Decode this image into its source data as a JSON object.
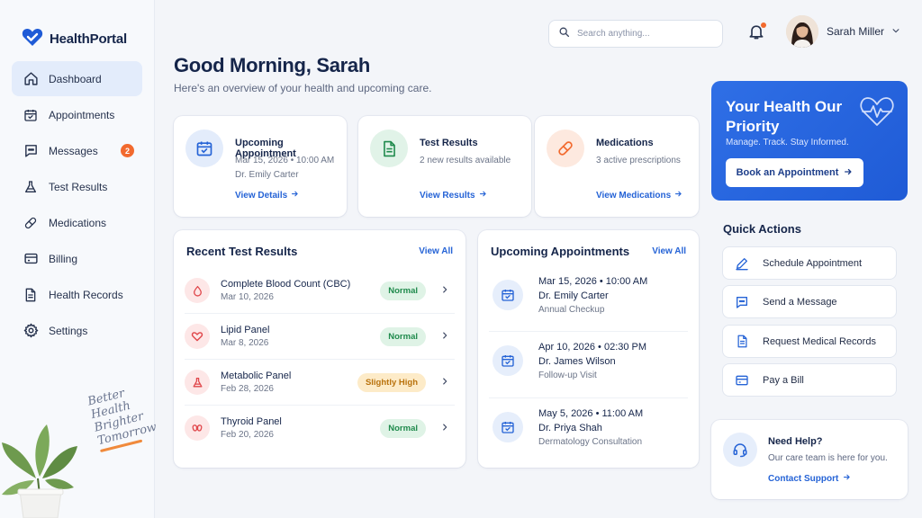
{
  "brand": {
    "name": "HealthPortal",
    "logo_icon": "heart-logo-icon",
    "color": "#1f5bd6"
  },
  "sidebar": {
    "items": [
      {
        "label": "Dashboard",
        "icon": "home-icon",
        "active": true
      },
      {
        "label": "Appointments",
        "icon": "calendar-icon"
      },
      {
        "label": "Messages",
        "icon": "chat-icon",
        "badge": "2"
      },
      {
        "label": "Test Results",
        "icon": "flask-icon"
      },
      {
        "label": "Medications",
        "icon": "pill-icon"
      },
      {
        "label": "Billing",
        "icon": "credit-card-icon"
      },
      {
        "label": "Health Records",
        "icon": "document-icon"
      },
      {
        "label": "Settings",
        "icon": "gear-icon"
      }
    ],
    "tagline": [
      "Better",
      "Health",
      "Brighter",
      "Tomorrow"
    ]
  },
  "header": {
    "search_placeholder": "Search anything...",
    "user_name": "Sarah Miller"
  },
  "greeting": {
    "title": "Good Morning, Sarah",
    "subtitle": "Here's an overview of your health and upcoming care."
  },
  "summary_cards": [
    {
      "title": "Upcoming Appointment",
      "line1": "Mar 15, 2026 • 10:00 AM",
      "line2": "Dr. Emily Carter",
      "link": "View Details",
      "icon": "calendar-icon",
      "accent": "#2563d6"
    },
    {
      "title": "Test Results",
      "line1": "2 new results available",
      "link": "View Results",
      "icon": "document-icon",
      "accent": "#1f8a4c"
    },
    {
      "title": "Medications",
      "line1": "3 active prescriptions",
      "link": "View Medications",
      "icon": "pill-icon",
      "accent": "#f26a2e"
    }
  ],
  "recent_results": {
    "title": "Recent Test Results",
    "link": "View All",
    "rows": [
      {
        "name": "Complete Blood Count (CBC)",
        "date": "Mar 10, 2026",
        "status": "Normal",
        "icon": "blood-drop-icon"
      },
      {
        "name": "Lipid Panel",
        "date": "Mar 8, 2026",
        "status": "Normal",
        "icon": "heart-icon"
      },
      {
        "name": "Metabolic Panel",
        "date": "Feb 28, 2026",
        "status": "Slightly High",
        "icon": "flask-icon"
      },
      {
        "name": "Thyroid Panel",
        "date": "Feb 20, 2026",
        "status": "Normal",
        "icon": "thyroid-icon"
      }
    ]
  },
  "upcoming_appointments": {
    "title": "Upcoming Appointments",
    "link": "View All",
    "rows": [
      {
        "date": "Mar 15, 2026 • 10:00 AM",
        "doctor": "Dr. Emily Carter",
        "type": "Annual Checkup"
      },
      {
        "date": "Apr 10, 2026 • 02:30 PM",
        "doctor": "Dr. James Wilson",
        "type": "Follow-up Visit"
      },
      {
        "date": "May 5, 2026 • 11:00 AM",
        "doctor": "Dr. Priya Shah",
        "type": "Dermatology Consultation"
      }
    ]
  },
  "promo": {
    "title": "Your Health Our Priority",
    "subtitle": "Manage. Track. Stay Informed.",
    "button": "Book an Appointment"
  },
  "quick_actions": {
    "title": "Quick Actions",
    "items": [
      {
        "label": "Schedule Appointment",
        "icon": "pen-icon"
      },
      {
        "label": "Send a Message",
        "icon": "chat-icon"
      },
      {
        "label": "Request Medical Records",
        "icon": "document-icon"
      },
      {
        "label": "Pay a Bill",
        "icon": "credit-card-icon"
      }
    ]
  },
  "help": {
    "title": "Need Help?",
    "subtitle": "Our care team is here for you.",
    "link": "Contact Support"
  }
}
